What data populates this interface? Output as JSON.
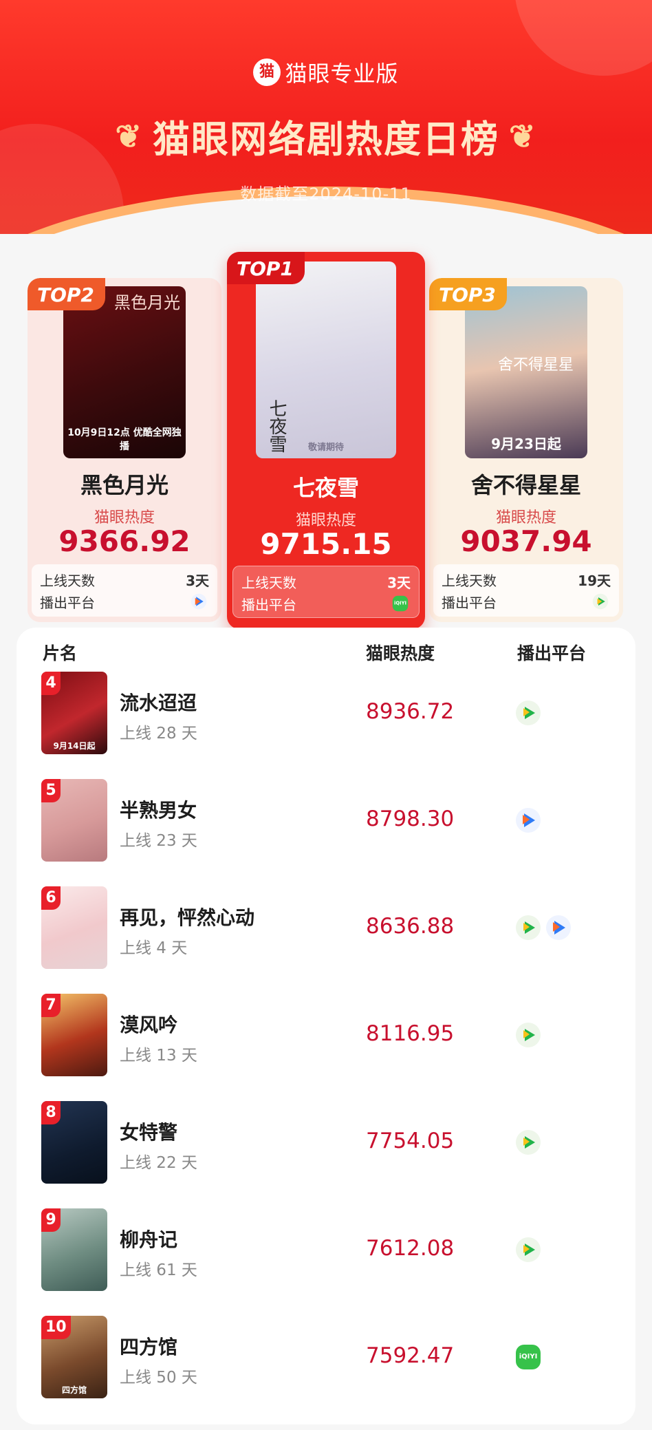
{
  "header": {
    "brand": "猫眼专业版",
    "brand_logo": "猫",
    "title": "猫眼网络剧热度日榜",
    "laurel_left": "❦",
    "laurel_right": "❦",
    "date_line": "数据截至2024-10-11"
  },
  "top": [
    {
      "rank_label": "TOP1",
      "name": "七夜雪",
      "heat_label": "猫眼热度",
      "heat": "9715.15",
      "days_label": "上线天数",
      "days": "3天",
      "platform_label": "播出平台",
      "platform_icon": "iqiyi-icon",
      "poster_art": "七夜雪",
      "poster_caption": "敬请期待"
    },
    {
      "rank_label": "TOP2",
      "name": "黑色月光",
      "heat_label": "猫眼热度",
      "heat": "9366.92",
      "days_label": "上线天数",
      "days": "3天",
      "platform_label": "播出平台",
      "platform_icon": "youku-icon",
      "poster_art": "黑色月光",
      "poster_caption": "10月9日12点 优酷全网独播"
    },
    {
      "rank_label": "TOP3",
      "name": "舍不得星星",
      "heat_label": "猫眼热度",
      "heat": "9037.94",
      "days_label": "上线天数",
      "days": "19天",
      "platform_label": "播出平台",
      "platform_icon": "tencent-video-icon",
      "poster_art": "舍不得星星",
      "poster_caption": "9月23日起"
    }
  ],
  "table": {
    "headers": {
      "name": "片名",
      "heat": "猫眼热度",
      "platform": "播出平台"
    },
    "rows": [
      {
        "rank": "4",
        "title": "流水迢迢",
        "days": "上线 28 天",
        "heat": "8936.72",
        "platforms": [
          "tencent-video-icon"
        ],
        "thumb_caption": "9月14日起"
      },
      {
        "rank": "5",
        "title": "半熟男女",
        "days": "上线 23 天",
        "heat": "8798.30",
        "platforms": [
          "youku-icon"
        ],
        "thumb_caption": ""
      },
      {
        "rank": "6",
        "title": "再见，怦然心动",
        "days": "上线 4 天",
        "heat": "8636.88",
        "platforms": [
          "tencent-video-icon",
          "youku-icon"
        ],
        "thumb_caption": ""
      },
      {
        "rank": "7",
        "title": "漠风吟",
        "days": "上线 13 天",
        "heat": "8116.95",
        "platforms": [
          "tencent-video-icon"
        ],
        "thumb_caption": ""
      },
      {
        "rank": "8",
        "title": "女特警",
        "days": "上线 22 天",
        "heat": "7754.05",
        "platforms": [
          "tencent-video-icon"
        ],
        "thumb_caption": ""
      },
      {
        "rank": "9",
        "title": "柳舟记",
        "days": "上线 61 天",
        "heat": "7612.08",
        "platforms": [
          "tencent-video-icon"
        ],
        "thumb_caption": ""
      },
      {
        "rank": "10",
        "title": "四方馆",
        "days": "上线 50 天",
        "heat": "7592.47",
        "platforms": [
          "iqiyi-icon"
        ],
        "thumb_caption": "四方馆"
      }
    ]
  },
  "icons": {
    "iqiyi_text": "iQIYI"
  },
  "colors": {
    "header_red": "#f21f1d",
    "heat_red": "#c8102e",
    "top1_bg": "#ee2822",
    "top2_bg": "#fbe7e3",
    "top3_bg": "#fbf0e3",
    "tencent_green": "#22b34a",
    "youku_blue": "#2f7bf6",
    "iqiyi_green": "#36c24a"
  }
}
